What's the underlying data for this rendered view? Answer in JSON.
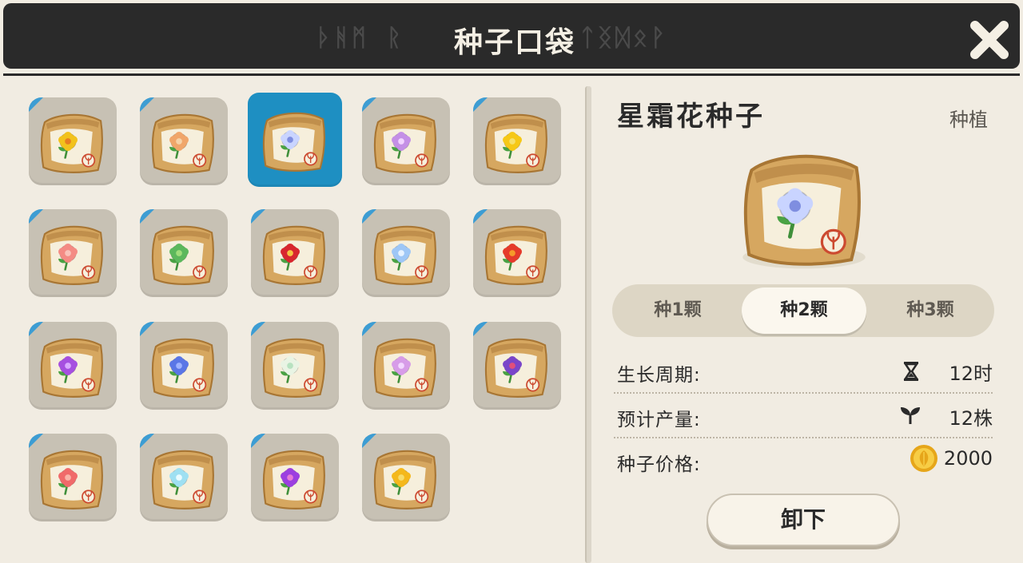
{
  "header": {
    "title": "种子口袋",
    "deco_left": "ᚦᚻᛗ ᚱ",
    "deco_right": "ᛏᛝᛞᛟᚹ"
  },
  "seeds": [
    {
      "flower": "yellow-flower",
      "color": "#f2c21c",
      "center": "#e67e22"
    },
    {
      "flower": "orange-mushroom",
      "color": "#f0a66a",
      "center": "#f6d2a8"
    },
    {
      "flower": "blue-white-flower",
      "color": "#c9d4ff",
      "center": "#7f8ee0",
      "selected": true
    },
    {
      "flower": "purple-flower",
      "color": "#c48fe6",
      "center": "#f1d3ff"
    },
    {
      "flower": "yellow-bell",
      "color": "#f6c816",
      "center": "#f6e06a"
    },
    {
      "flower": "pink-blossom",
      "color": "#f48b84",
      "center": "#f9c2b9"
    },
    {
      "flower": "green-bud",
      "color": "#5cb85c",
      "center": "#9fdc7a"
    },
    {
      "flower": "red-camellia",
      "color": "#d8262e",
      "center": "#f5c242"
    },
    {
      "flower": "blue-lotus",
      "color": "#9ec7f6",
      "center": "#e6f2ff"
    },
    {
      "flower": "red-rose",
      "color": "#e53a2a",
      "center": "#f59a2a"
    },
    {
      "flower": "purple-lily",
      "color": "#a64fe0",
      "center": "#d9a9ff"
    },
    {
      "flower": "blue-mushroom",
      "color": "#5a76e6",
      "center": "#9fb2ff"
    },
    {
      "flower": "white-lily",
      "color": "#e9f4e4",
      "center": "#b7e2c0"
    },
    {
      "flower": "lilac-flower",
      "color": "#d79ce8",
      "center": "#f3d7ff"
    },
    {
      "flower": "violet-flower",
      "color": "#7a45c9",
      "center": "#e14f7a"
    },
    {
      "flower": "pink-rose",
      "color": "#f06a6a",
      "center": "#f9b3a8"
    },
    {
      "flower": "cyan-flower",
      "color": "#9fe0f2",
      "center": "#e9fbff"
    },
    {
      "flower": "purple-bulb",
      "color": "#9c3fe0",
      "center": "#e67ad6"
    },
    {
      "flower": "golden-tulip",
      "color": "#f4b81c",
      "center": "#f7dc6a"
    }
  ],
  "detail": {
    "name": "星霜花种子",
    "category": "种植",
    "options": [
      "种1颗",
      "种2颗",
      "种3颗"
    ],
    "selected_option": 1,
    "growth_label": "生长周期:",
    "growth_value": "12时",
    "yield_label": "预计产量:",
    "yield_value": "12株",
    "price_label": "种子价格:",
    "price_value": "2000",
    "unload_label": "卸下"
  },
  "colors": {
    "header_bg": "#2a2a2a",
    "panel_bg": "#f1ece2",
    "selected_tile": "#1e8fc2",
    "tile_bg": "#c7c1b4",
    "sack": "#d6a760"
  }
}
